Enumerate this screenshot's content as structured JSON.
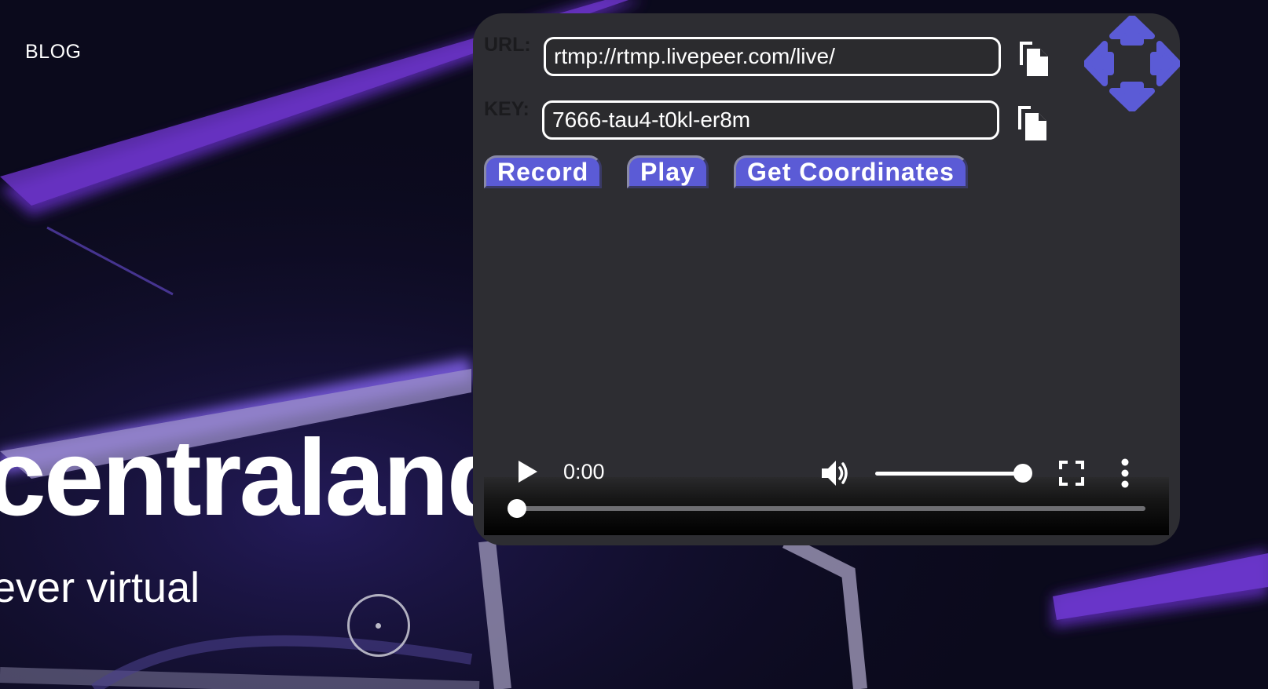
{
  "nav": {
    "blog_label": "BLOG"
  },
  "hero": {
    "title": "centraland",
    "subtitle": "ever virtual"
  },
  "panel": {
    "url_label": "URL:",
    "url_value": "rtmp://rtmp.livepeer.com/live/",
    "key_label": "KEY:",
    "key_value": "7666-tau4-t0kl-er8m",
    "copy_icon": "copy-icon",
    "move_icon": "move-arrows-icon",
    "buttons": {
      "record": "Record",
      "play": "Play",
      "coordinates": "Get Coordinates"
    }
  },
  "player": {
    "time": "0:00",
    "volume": 1.0,
    "progress": 0.0,
    "icons": [
      "play-icon",
      "volume-icon",
      "fullscreen-icon",
      "more-options-icon"
    ]
  },
  "colors": {
    "accent": "#5b5bd6",
    "panel_bg": "#2d2d32",
    "page_bg": "#0b0a1c"
  }
}
